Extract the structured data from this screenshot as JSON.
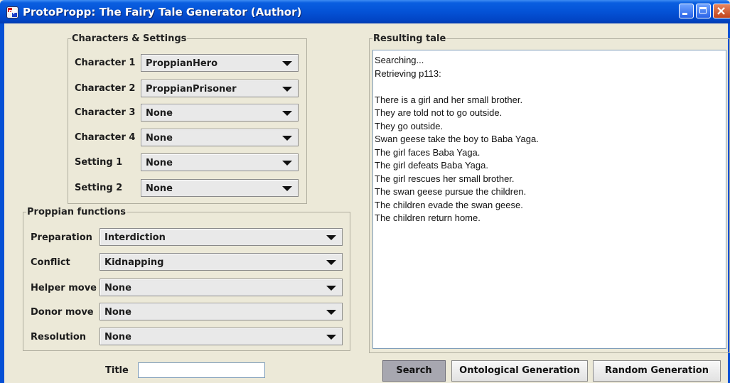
{
  "window": {
    "title": "ProtoPropp: The Fairy Tale Generator (Author)",
    "app_icon_text": "PP",
    "close_glyph": "×"
  },
  "characters_settings": {
    "legend": "Characters & Settings",
    "rows": [
      {
        "label": "Character 1",
        "value": "ProppianHero"
      },
      {
        "label": "Character 2",
        "value": "ProppianPrisoner"
      },
      {
        "label": "Character 3",
        "value": "None"
      },
      {
        "label": "Character 4",
        "value": "None"
      },
      {
        "label": "Setting 1",
        "value": "None"
      },
      {
        "label": "Setting 2",
        "value": "None"
      }
    ]
  },
  "proppian_functions": {
    "legend": "Proppian functions",
    "rows": [
      {
        "label": "Preparation",
        "value": "Interdiction"
      },
      {
        "label": "Conflict",
        "value": "Kidnapping"
      },
      {
        "label": "Helper move",
        "value": "None"
      },
      {
        "label": "Donor move",
        "value": "None"
      },
      {
        "label": "Resolution",
        "value": "None"
      }
    ]
  },
  "resulting_tale": {
    "legend": "Resulting tale",
    "lines": [
      "Searching...",
      "Retrieving p113:",
      "",
      "There is a girl and her small brother.",
      "They are told not to go outside.",
      "They go outside.",
      "Swan geese take the boy to Baba Yaga.",
      "The girl faces Baba Yaga.",
      "The girl defeats Baba Yaga.",
      "The girl rescues her small brother.",
      "The swan geese pursue the children.",
      "The children evade the swan geese.",
      "The children return home."
    ]
  },
  "title_field": {
    "label": "Title",
    "value": ""
  },
  "buttons": {
    "search": "Search",
    "ontological": "Ontological Generation",
    "random": "Random Generation"
  },
  "colors": {
    "titlebar": "#0452d6",
    "background": "#ece9d8",
    "pressed_button": "#a7a7b0"
  }
}
